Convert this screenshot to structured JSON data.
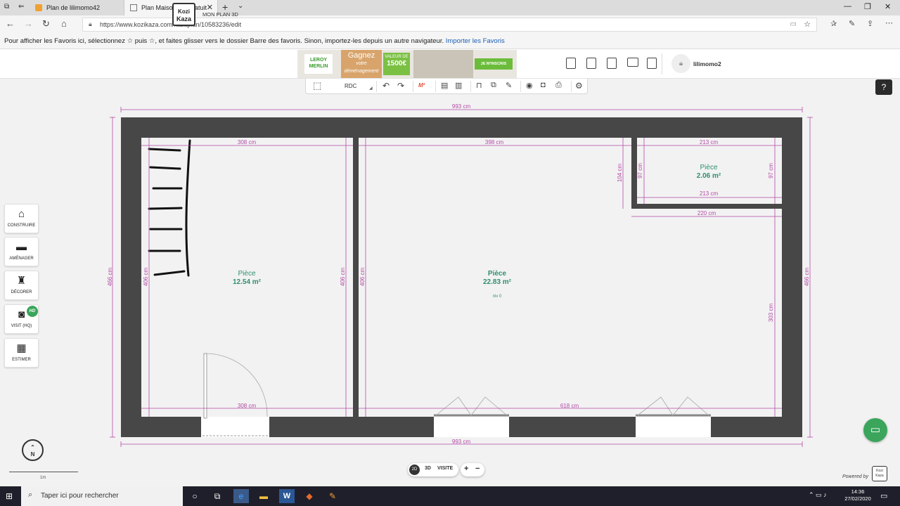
{
  "browser": {
    "tabs": [
      {
        "title": "Plan de lilimomo42"
      },
      {
        "title": "Plan Maison 3D Gratuit"
      }
    ],
    "url": "https://www.kozikaza.com/kazaplan/10583236/edit",
    "favorites_hint": "Pour afficher les Favoris ici, sélectionnez ☆ puis ☆, et faites glisser vers le dossier Barre des favoris. Sinon, importez-les depuis un autre navigateur.",
    "favorites_link": "Importer les Favoris"
  },
  "header": {
    "logo_top": "Kozi",
    "logo_bottom": "Kaza",
    "app_label": "MON PLAN 3D",
    "ad": {
      "brand": "LEROY MERLIN",
      "headline": "Gagnez",
      "sub1": "votre",
      "sub2": "déménagement",
      "value_label": "VALEUR DE",
      "value": "1500€",
      "cta": "JE M'INSCRIS"
    },
    "username": "lilimomo2"
  },
  "toolbar": {
    "level": "RDC",
    "m2_label": "M²"
  },
  "left_menu": [
    {
      "label": "CONSTRUIRE",
      "icon": "house-icon"
    },
    {
      "label": "AMÉNAGER",
      "icon": "sofa-icon"
    },
    {
      "label": "DÉCORER",
      "icon": "lamp-icon"
    },
    {
      "label": "VISIT (HQ)",
      "icon": "camera-icon",
      "badge": "HD"
    },
    {
      "label": "ESTIMER",
      "icon": "calculator-icon"
    }
  ],
  "compass_label": "N",
  "scale_label": "1m",
  "view_modes": {
    "mode_2d": "2D",
    "mode_3d": "3D",
    "visit": "VISITE",
    "active": "2D"
  },
  "zoom": {
    "plus": "+",
    "minus": "−"
  },
  "powered_by": "Powered by",
  "plan": {
    "outer_width_top": "993 cm",
    "outer_width_bottom": "993 cm",
    "outer_height_left": "466 cm",
    "outer_height_right": "466 cm",
    "rooms": [
      {
        "name": "Pièce",
        "area": "12.54 m²",
        "width_top": "308 cm",
        "width_bottom": "308 cm",
        "height_left": "406 cm",
        "height_right": "406 cm"
      },
      {
        "name": "Pièce",
        "area": "22.83 m²",
        "level": "niv 0",
        "width_top": "398 cm",
        "width_bottom": "618 cm",
        "height_left": "406 cm",
        "height_right": "303 cm",
        "inner_height": "104 cm",
        "inner_width": "220 cm"
      },
      {
        "name": "Pièce",
        "area": "2.06 m²",
        "width_top": "213 cm",
        "width_bottom": "213 cm",
        "height_left": "97 cm",
        "height_right": "97 cm"
      }
    ]
  },
  "taskbar": {
    "search_placeholder": "Taper ici pour rechercher",
    "time": "14:36",
    "date": "27/02/2020"
  },
  "colors": {
    "wall": "#474747",
    "dimension": "#b34aa6",
    "room_label": "#2f8f6f",
    "accent_green": "#3aa55b"
  }
}
